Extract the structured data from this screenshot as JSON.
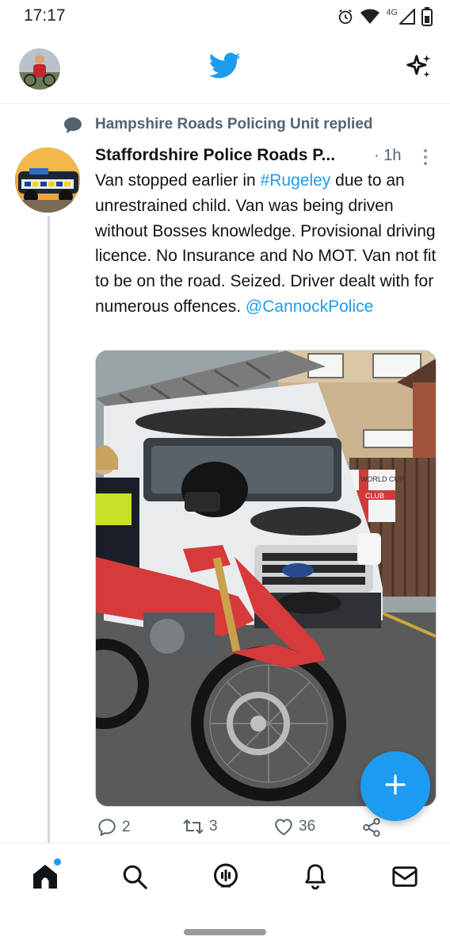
{
  "status_bar": {
    "time": "17:17",
    "network": "4G",
    "icons": [
      "alarm-icon",
      "wifi-icon",
      "signal-icon",
      "battery-icon"
    ]
  },
  "app_bar": {
    "profile_avatar": "profile-avatar",
    "logo": "twitter-bird-icon",
    "sparkle": "sparkle-icon"
  },
  "reply_context": {
    "text": "Hampshire Roads Policing Unit replied",
    "icon": "reply-bubble-icon"
  },
  "tweet": {
    "author": "Staffordshire Police Roads P...",
    "time": "· 1h",
    "text_parts": {
      "p1": "Van stopped earlier in ",
      "hashtag": "#Rugeley",
      "p2": " due to an unrestrained child. Van was being driven without Bosses knowledge. Provisional driving licence. No Insurance and No MOT.  Van not fit to be on the road. Seized. Driver dealt with for numerous offences. ",
      "mention": "@CannockPolice"
    },
    "media": {
      "description_icon": "photo",
      "sign_text": "WORLD CUP CLUB"
    },
    "actions": {
      "replies": "2",
      "retweets": "3",
      "likes": "36"
    }
  },
  "bottom_nav": {
    "items": [
      "home-icon",
      "search-icon",
      "spaces-icon",
      "notifications-icon",
      "messages-icon"
    ]
  },
  "colors": {
    "accent": "#1d9bf0",
    "secondary_text": "#536471",
    "primary_text": "#0f1419"
  }
}
